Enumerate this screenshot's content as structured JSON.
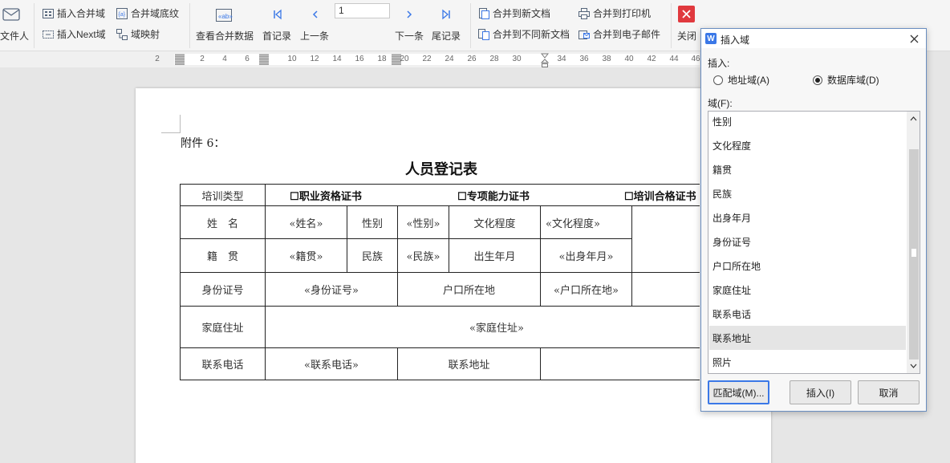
{
  "ribbon": {
    "recipient_label": "文件人",
    "insert_merge_field": "插入合并域",
    "merge_field_shading": "合并域底纹",
    "insert_next_field": "插入Next域",
    "field_mapping": "域映射",
    "view_merged_data": "查看合并数据",
    "first_record": "首记录",
    "prev_record": "上一条",
    "record_number": "1",
    "next_record": "下一条",
    "last_record": "尾记录",
    "merge_to_new_doc": "合并到新文档",
    "merge_to_diff_docs": "合并到不同新文档",
    "merge_to_printer": "合并到打印机",
    "merge_to_email": "合并到电子邮件",
    "close": "关闭",
    "close_color": "#e0393e"
  },
  "ruler": {
    "ticks": [
      "2",
      "2",
      "4",
      "6",
      "10",
      "12",
      "14",
      "16",
      "18",
      "20",
      "22",
      "24",
      "26",
      "28",
      "30",
      "34",
      "36",
      "38",
      "40",
      "42",
      "44",
      "46"
    ]
  },
  "document": {
    "attachment": "附件 6：",
    "title": "人员登记表",
    "table": {
      "training_type": "培训类型",
      "opt_vocational": "☐职业资格证书",
      "opt_special": "☐专项能力证书",
      "opt_training": "☐培训合格证书",
      "name_label": "姓　名",
      "name_field": "«姓名»",
      "gender_label": "性别",
      "gender_field": "«性别»",
      "education_label": "文化程度",
      "education_field": "«文化程度»",
      "native_label": "籍　贯",
      "native_field": "«籍贯»",
      "ethnic_label": "民族",
      "ethnic_field": "«民族»",
      "birth_label": "出生年月",
      "birth_field": "«出身年月»",
      "id_label": "身份证号",
      "id_field": "«身份证号»",
      "hukou_label": "户口所在地",
      "hukou_field": "«户口所在地»",
      "address_label": "家庭住址",
      "address_field": "«家庭住址»",
      "phone_label": "联系电话",
      "phone_field": "«联系电话»",
      "contact_addr_label": "联系地址"
    }
  },
  "dialog": {
    "title": "插入域",
    "insert_label": "插入:",
    "radio_address": "地址域(A)",
    "radio_database": "数据库域(D)",
    "selected_radio": "database",
    "fields_label": "域(F):",
    "fields": [
      "性别",
      "文化程度",
      "籍贯",
      "民族",
      "出身年月",
      "身份证号",
      "户口所在地",
      "家庭住址",
      "联系电话",
      "联系地址",
      "照片"
    ],
    "selected_field": "联系地址",
    "match_button": "匹配域(M)...",
    "insert_button": "插入(I)",
    "cancel_button": "取消"
  }
}
